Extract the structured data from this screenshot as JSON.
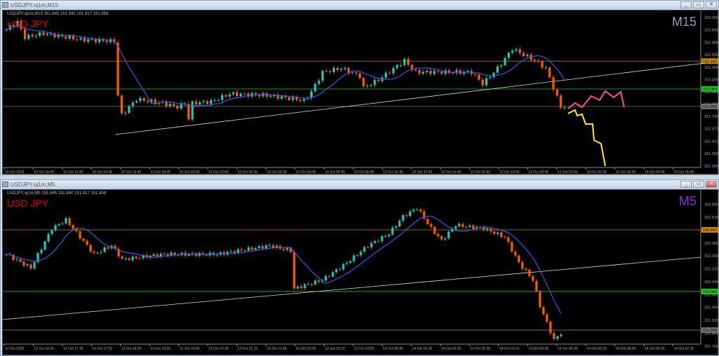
{
  "windows": [
    {
      "title": "USDJPY.oj1m,M15",
      "info": "USDJPY.oj1m,M15  151.845 151.890 151.817 151.858",
      "symbol": "USD JPY",
      "timeframe": "M15",
      "tf_color": "#8a9bb0",
      "price_labels": [
        "153.005",
        "152.845",
        "152.685",
        "152.525",
        "152.365",
        "152.205",
        "152.045",
        "151.890",
        "151.730",
        "151.570",
        "151.410",
        "151.250",
        "151.090"
      ],
      "levels": [
        {
          "price": 152.442,
          "label": "152.442",
          "color": "#c8860a"
        },
        {
          "price": 152.083,
          "label": "152.083",
          "color": "#22c422"
        },
        {
          "price": 151.858,
          "label": "151.858",
          "color": "#777777"
        }
      ],
      "time_labels": [
        "10 Oct 2025",
        "10 Oct 10:45",
        "10 Oct 12:45",
        "10 Oct 14:45",
        "10 Oct 16:45",
        "10 Oct 18:45",
        "10 Oct 20:45",
        "10 Oct 22:45",
        "13 Oct 00:45",
        "13 Oct 02:45",
        "13 Oct 04:45",
        "13 Oct 06:45",
        "13 Oct 08:45",
        "13 Oct 10:45",
        "13 Oct 12:45",
        "13 Oct 14:45",
        "13 Oct 16:45",
        "13 Oct 18:45",
        "13 Oct 20:45",
        "13 Oct 22:45",
        "14 Oct 00:45",
        "14 Oct 02:45",
        "14 Oct 04:45",
        "14 Oct 06:45"
      ],
      "price_path": [
        [
          0,
          152.85
        ],
        [
          3,
          152.95
        ],
        [
          5,
          152.75
        ],
        [
          10,
          152.8
        ],
        [
          20,
          152.72
        ],
        [
          29,
          152.7
        ],
        [
          30,
          152.0
        ],
        [
          31,
          151.75
        ],
        [
          35,
          151.95
        ],
        [
          42,
          151.9
        ],
        [
          46,
          151.85
        ],
        [
          48,
          151.9
        ],
        [
          49,
          151.7
        ],
        [
          50,
          151.9
        ],
        [
          55,
          151.92
        ],
        [
          60,
          152.02
        ],
        [
          70,
          152.0
        ],
        [
          78,
          151.95
        ],
        [
          80,
          151.93
        ],
        [
          82,
          152.05
        ],
        [
          85,
          152.3
        ],
        [
          90,
          152.35
        ],
        [
          95,
          152.25
        ],
        [
          96,
          152.1
        ],
        [
          100,
          152.2
        ],
        [
          107,
          152.45
        ],
        [
          110,
          152.3
        ],
        [
          125,
          152.3
        ],
        [
          128,
          152.15
        ],
        [
          132,
          152.35
        ],
        [
          136,
          152.6
        ],
        [
          142,
          152.45
        ],
        [
          145,
          152.35
        ],
        [
          147,
          152.1
        ],
        [
          149,
          151.85
        ],
        [
          150,
          151.86
        ]
      ]
    },
    {
      "title": "USDJPY.oj1m,M5",
      "info": "USDJPY.oj1m,M5  151.845 151.890 151.817 151.858",
      "symbol": "USD JPY",
      "timeframe": "M5",
      "tf_color": "#8a2be2",
      "price_labels": [
        "152.590",
        "152.515",
        "152.365",
        "152.290",
        "152.215",
        "152.140",
        "152.065",
        "151.990",
        "151.915",
        "151.840",
        "151.765"
      ],
      "levels": [
        {
          "price": 152.442,
          "label": "152.442",
          "color": "#c8860a"
        },
        {
          "price": 152.083,
          "label": "152.083",
          "color": "#22c422"
        },
        {
          "price": 151.858,
          "label": "151.858",
          "color": "#777777"
        }
      ],
      "time_labels": [
        "13 Oct 2025",
        "13 Oct 16:35",
        "13 Oct 17:15",
        "13 Oct 17:55",
        "13 Oct 18:35",
        "13 Oct 19:15",
        "13 Oct 19:55",
        "13 Oct 20:35",
        "13 Oct 21:15",
        "13 Oct 21:55",
        "13 Oct 22:35",
        "13 Oct 23:15",
        "13 Oct 23:55",
        "14 Oct 00:35",
        "14 Oct 01:15",
        "14 Oct 01:55",
        "14 Oct 02:35",
        "14 Oct 03:15",
        "14 Oct 03:55",
        "14 Oct 04:35",
        "14 Oct 05:15",
        "14 Oct 05:55",
        "14 Oct 06:35",
        "14 Oct 07:15"
      ],
      "price_path": [
        [
          0,
          152.3
        ],
        [
          7,
          152.22
        ],
        [
          13,
          152.45
        ],
        [
          17,
          152.5
        ],
        [
          25,
          152.3
        ],
        [
          30,
          152.35
        ],
        [
          33,
          152.27
        ],
        [
          45,
          152.3
        ],
        [
          60,
          152.3
        ],
        [
          75,
          152.35
        ],
        [
          81,
          152.32
        ],
        [
          82,
          152.1
        ],
        [
          90,
          152.15
        ],
        [
          97,
          152.25
        ],
        [
          103,
          152.35
        ],
        [
          109,
          152.42
        ],
        [
          113,
          152.52
        ],
        [
          117,
          152.57
        ],
        [
          121,
          152.45
        ],
        [
          124,
          152.38
        ],
        [
          128,
          152.47
        ],
        [
          136,
          152.45
        ],
        [
          142,
          152.4
        ],
        [
          146,
          152.25
        ],
        [
          150,
          152.15
        ],
        [
          152,
          152.0
        ],
        [
          154,
          151.9
        ],
        [
          156,
          151.8
        ],
        [
          158,
          151.84
        ]
      ]
    }
  ]
}
